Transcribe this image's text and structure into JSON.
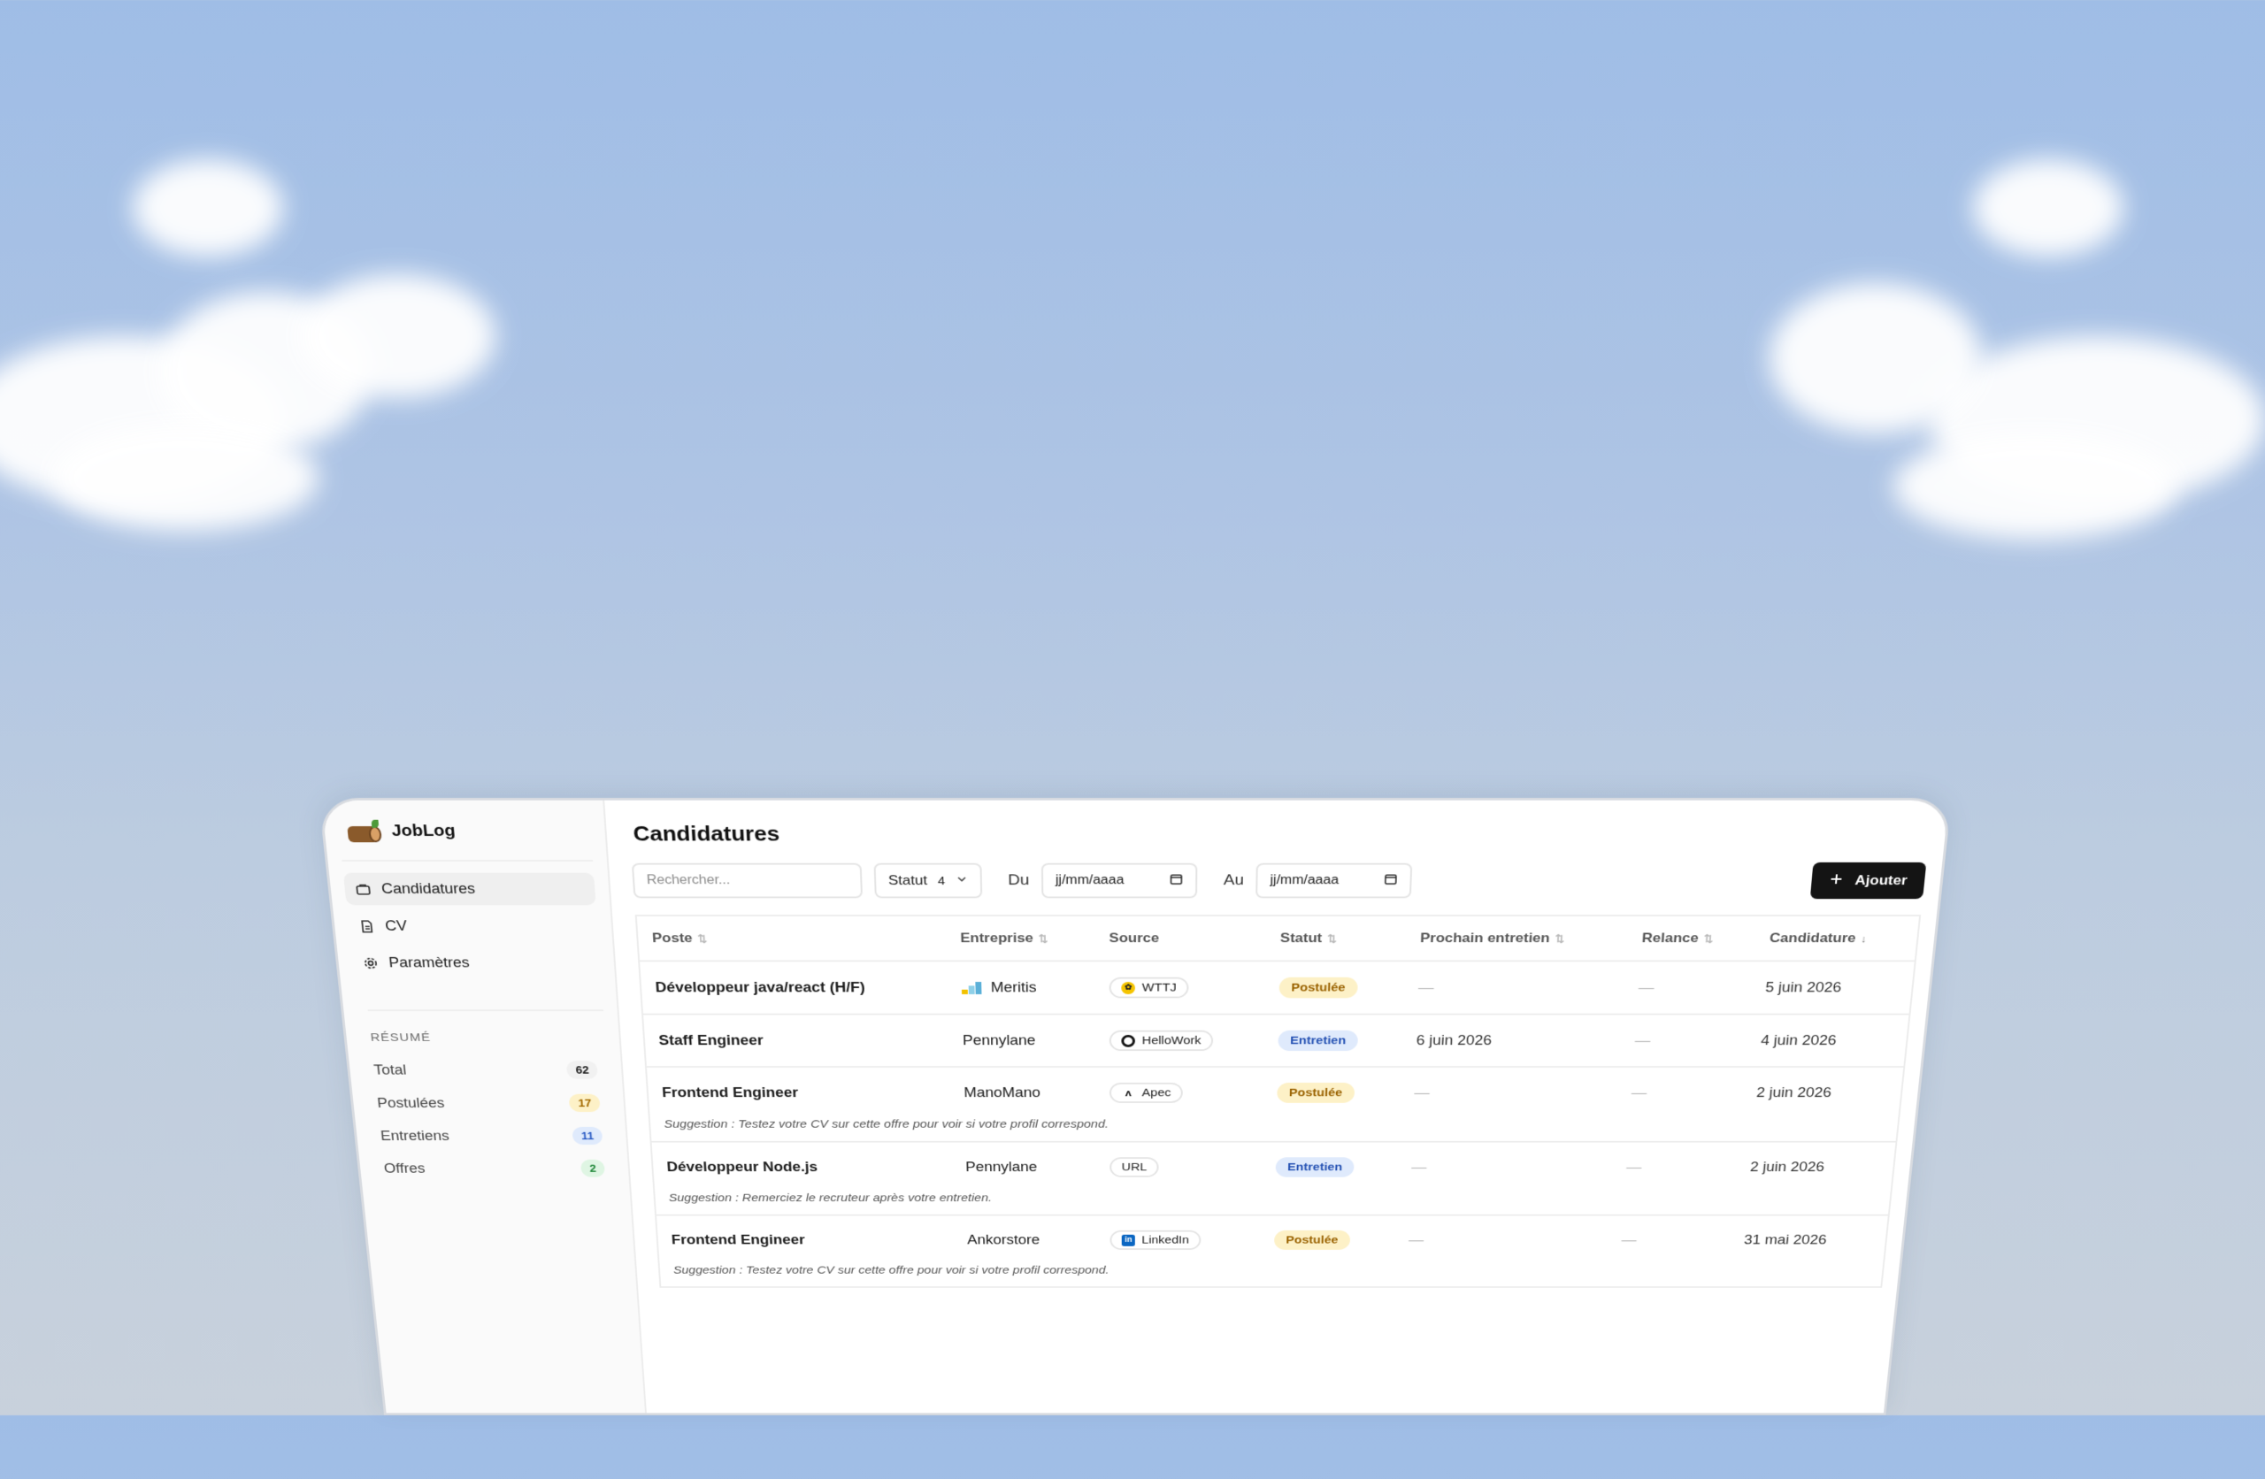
{
  "app": {
    "name": "JobLog"
  },
  "sidebar": {
    "items": [
      {
        "label": "Candidatures",
        "icon": "briefcase-icon",
        "active": true
      },
      {
        "label": "CV",
        "icon": "document-icon",
        "active": false
      },
      {
        "label": "Paramètres",
        "icon": "gear-icon",
        "active": false
      }
    ],
    "summary_label": "RÉSUMÉ",
    "summary": [
      {
        "label": "Total",
        "count": "62",
        "color": "#f1f1f1"
      },
      {
        "label": "Postulées",
        "count": "17",
        "color": "#fdf1c7"
      },
      {
        "label": "Entretiens",
        "count": "11",
        "color": "#dfeafc"
      },
      {
        "label": "Offres",
        "count": "2",
        "color": "#dff5e3"
      }
    ]
  },
  "main": {
    "title": "Candidatures",
    "search_placeholder": "Rechercher...",
    "status_filter": {
      "label": "Statut",
      "count": "4"
    },
    "date_from_label": "Du",
    "date_to_label": "Au",
    "date_placeholder": "jj/mm/aaaa",
    "add_label": "Ajouter"
  },
  "table": {
    "columns": [
      "Poste",
      "Entreprise",
      "Source",
      "Statut",
      "Prochain entretien",
      "Relance",
      "Candidature"
    ],
    "rows": [
      {
        "poste": "Développeur java/react (H/F)",
        "entreprise": "Meritis",
        "source": "WTTJ",
        "statut": "Postulée",
        "prochain": "—",
        "relance": "—",
        "candidature": "5 juin 2026",
        "suggestion": ""
      },
      {
        "poste": "Staff Engineer",
        "entreprise": "Pennylane",
        "source": "HelloWork",
        "statut": "Entretien",
        "prochain": "6 juin 2026",
        "relance": "—",
        "candidature": "4 juin 2026",
        "suggestion": ""
      },
      {
        "poste": "Frontend Engineer",
        "entreprise": "ManoMano",
        "source": "Apec",
        "statut": "Postulée",
        "prochain": "—",
        "relance": "—",
        "candidature": "2 juin 2026",
        "suggestion": "Suggestion : Testez votre CV sur cette offre pour voir si votre profil correspond."
      },
      {
        "poste": "Développeur Node.js",
        "entreprise": "Pennylane",
        "source": "URL",
        "statut": "Entretien",
        "prochain": "—",
        "relance": "—",
        "candidature": "2 juin 2026",
        "suggestion": "Suggestion : Remerciez le recruteur après votre entretien."
      },
      {
        "poste": "Frontend Engineer",
        "entreprise": "Ankorstore",
        "source": "LinkedIn",
        "statut": "Postulée",
        "prochain": "—",
        "relance": "—",
        "candidature": "31 mai 2026",
        "suggestion": "Suggestion : Testez votre CV sur cette offre pour voir si votre profil correspond."
      }
    ]
  },
  "colors": {
    "postulee_bg": "#fdf1c7",
    "entretien_bg": "#dfeafc",
    "button_bg": "#141414",
    "sky_top": "#9fbde6"
  }
}
